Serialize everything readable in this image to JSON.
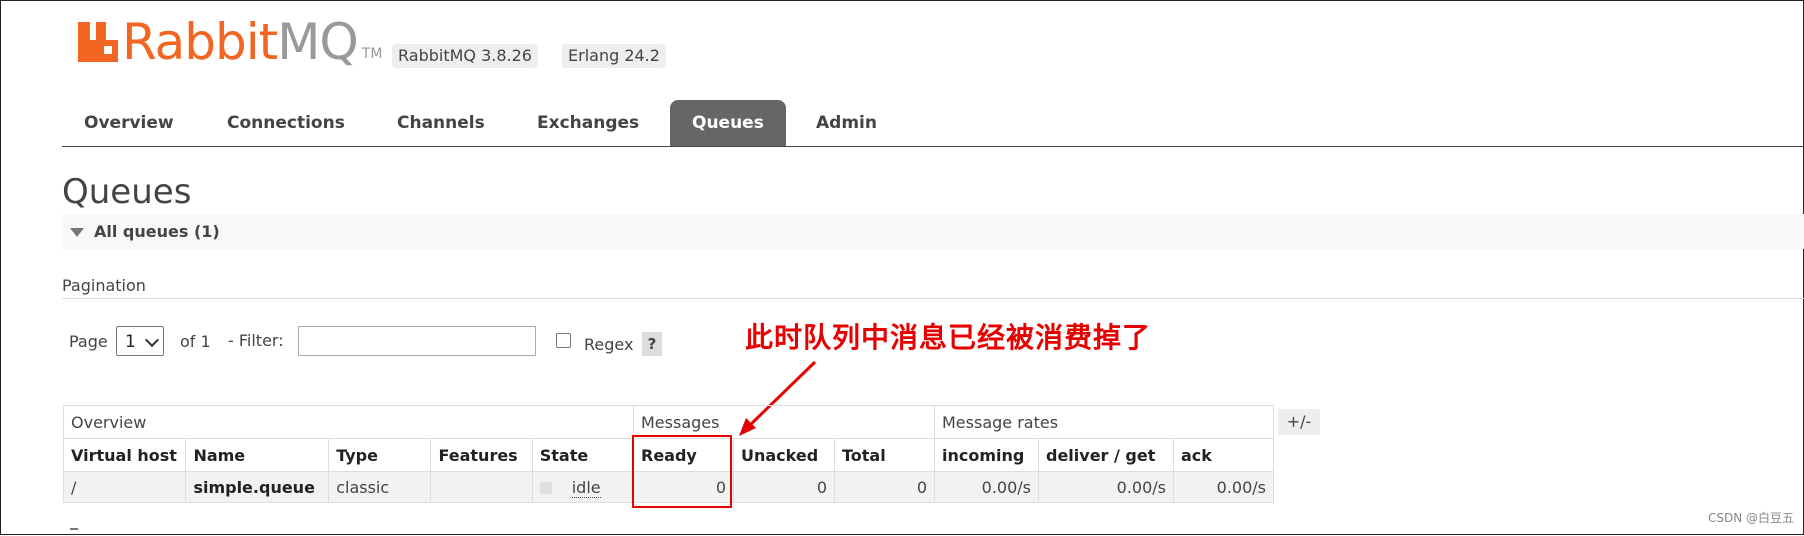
{
  "brand": {
    "rabbit": "Rabbit",
    "mq": "MQ",
    "tm": "TM",
    "versions": [
      "RabbitMQ 3.8.26",
      "Erlang 24.2"
    ]
  },
  "nav": {
    "tabs": [
      "Overview",
      "Connections",
      "Channels",
      "Exchanges",
      "Queues",
      "Admin"
    ],
    "active": "Queues"
  },
  "page": {
    "title": "Queues",
    "section_label": "All queues (1)"
  },
  "pagination": {
    "title": "Pagination",
    "page_label": "Page",
    "page_value": "1",
    "of_label": "of 1",
    "filter_label": "- Filter:",
    "filter_value": "",
    "regex_label": "Regex",
    "help_label": "?"
  },
  "table": {
    "groups": [
      "Overview",
      "Messages",
      "Message rates"
    ],
    "columns": [
      "Virtual host",
      "Name",
      "Type",
      "Features",
      "State",
      "Ready",
      "Unacked",
      "Total",
      "incoming",
      "deliver / get",
      "ack"
    ],
    "rows": [
      {
        "vhost": "/",
        "name": "simple.queue",
        "type": "classic",
        "features": "",
        "state": "idle",
        "ready": "0",
        "unacked": "0",
        "total": "0",
        "incoming": "0.00/s",
        "deliver_get": "0.00/s",
        "ack": "0.00/s"
      }
    ],
    "toggle_label": "+/-"
  },
  "annotation": {
    "text": "此时队列中消息已经被消费掉了",
    "color": "#e60000"
  },
  "watermark": "CSDN @白豆五",
  "colors": {
    "brand_orange": "#f26522",
    "nav_active_bg": "#666666"
  }
}
